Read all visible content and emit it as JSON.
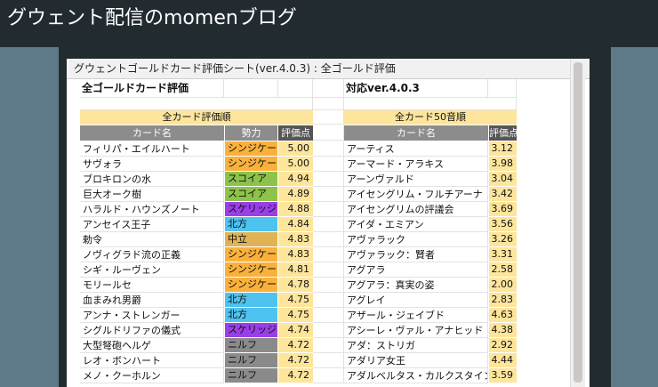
{
  "site": {
    "title": "グウェント配信のmomenブログ"
  },
  "sheet": {
    "title": "グウェントゴールドカード評価シート(ver.4.0.3) : 全ゴールド評価",
    "left_heading": "全ゴールドカード評価",
    "right_heading": "対応ver.4.0.3",
    "left_band": "全カード評価順",
    "right_band": "全カード50音順",
    "left_headers": {
      "name": "カード名",
      "faction": "勢力",
      "score": "評価点"
    },
    "right_headers": {
      "name": "カード名",
      "score": "評価点"
    }
  },
  "faction_colors": {
    "シンジケート": "#f9b13c",
    "スコイア": "#8dc34a",
    "スケリッジ": "#9a3fe8",
    "北方": "#4ec3f0",
    "中立": "#e0b355",
    "ニルフ": "#8a8a8a"
  },
  "left_rows": [
    {
      "name": "フィリパ・エイルハート",
      "faction": "シンジケート",
      "score": "5.00"
    },
    {
      "name": "サヴォラ",
      "faction": "シンジケート",
      "score": "5.00"
    },
    {
      "name": "ブロキロンの水",
      "faction": "スコイア",
      "score": "4.94"
    },
    {
      "name": "巨大オーク樹",
      "faction": "スコイア",
      "score": "4.89"
    },
    {
      "name": "ハラルド・ハウンズノート",
      "faction": "スケリッジ",
      "score": "4.88"
    },
    {
      "name": "アンセイス王子",
      "faction": "北方",
      "score": "4.84"
    },
    {
      "name": "勅令",
      "faction": "中立",
      "score": "4.83"
    },
    {
      "name": "ノヴィグラド流の正義",
      "faction": "シンジケート",
      "score": "4.83"
    },
    {
      "name": "シギ・ルーヴェン",
      "faction": "シンジケート",
      "score": "4.81"
    },
    {
      "name": "モリールセ",
      "faction": "シンジケート",
      "score": "4.78"
    },
    {
      "name": "血まみれ男爵",
      "faction": "北方",
      "score": "4.75"
    },
    {
      "name": "アンナ・ストレンガー",
      "faction": "北方",
      "score": "4.75"
    },
    {
      "name": "シグルドリファの儀式",
      "faction": "スケリッジ",
      "score": "4.74"
    },
    {
      "name": "大型弩砲ヘルゲ",
      "faction": "ニルフ",
      "score": "4.72"
    },
    {
      "name": "レオ・ボンハート",
      "faction": "ニルフ",
      "score": "4.72"
    },
    {
      "name": "メノ・クーホルン",
      "faction": "ニルフ",
      "score": "4.72"
    }
  ],
  "right_rows": [
    {
      "name": "アーティス",
      "score": "3.12"
    },
    {
      "name": "アーマード・アラキス",
      "score": "3.98"
    },
    {
      "name": "アーンヴァルド",
      "score": "3.04"
    },
    {
      "name": "アイセングリム・フルチアーナ",
      "score": "3.42"
    },
    {
      "name": "アイセングリムの評議会",
      "score": "3.69"
    },
    {
      "name": "アイダ・エミアン",
      "score": "3.56"
    },
    {
      "name": "アヴァラック",
      "score": "3.26"
    },
    {
      "name": "アヴァラック：賢者",
      "score": "3.31"
    },
    {
      "name": "アグアラ",
      "score": "2.58"
    },
    {
      "name": "アグアラ：真実の姿",
      "score": "2.00"
    },
    {
      "name": "アグレイ",
      "score": "2.83"
    },
    {
      "name": "アザール・ジェイブド",
      "score": "4.63"
    },
    {
      "name": "アシーレ・ヴァル・アナヒッド",
      "score": "4.38"
    },
    {
      "name": "アダ：ストリガ",
      "score": "2.92"
    },
    {
      "name": "アダリア女王",
      "score": "4.44"
    },
    {
      "name": "アダルベルタス・カルクスタイン",
      "score": "3.59"
    }
  ]
}
